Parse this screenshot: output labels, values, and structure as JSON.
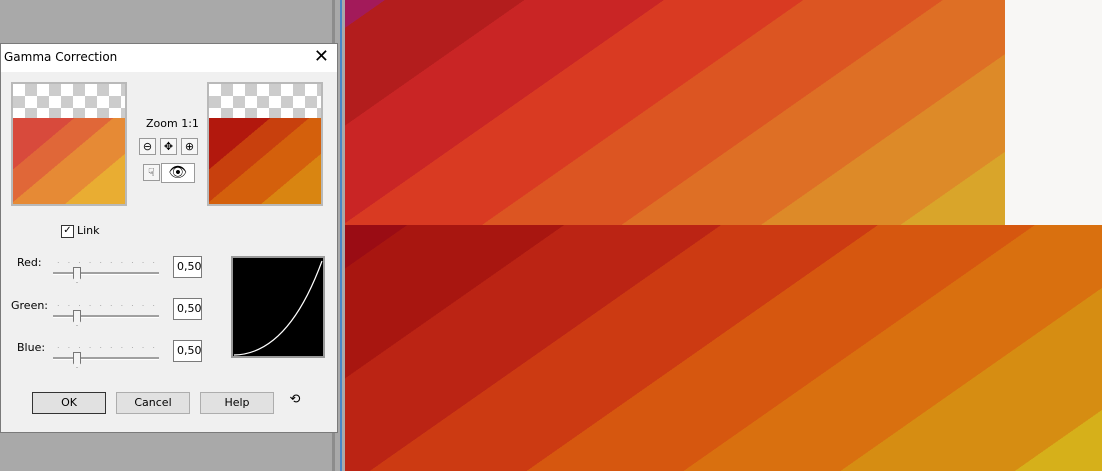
{
  "dialog": {
    "title": "Gamma Correction",
    "zoom_label": "Zoom 1:1",
    "link_label": "Link",
    "link_checked": true,
    "channels": [
      {
        "label": "Red:",
        "value": "0,50"
      },
      {
        "label": "Green:",
        "value": "0,50"
      },
      {
        "label": "Blue:",
        "value": "0,50"
      }
    ],
    "buttons": {
      "ok": "OK",
      "cancel": "Cancel",
      "help": "Help"
    },
    "icons": {
      "close": "close-icon",
      "zoom_out": "zoom-out-icon",
      "pan": "pan-icon",
      "zoom_in": "zoom-in-icon",
      "hand": "hand-icon",
      "eye": "eye-icon",
      "reset": "reset-icon"
    }
  }
}
